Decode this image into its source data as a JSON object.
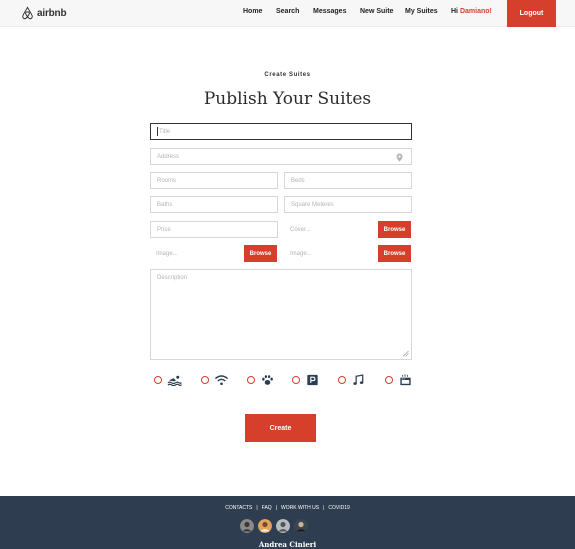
{
  "header": {
    "brand": "airbnb",
    "nav": [
      "Home",
      "Search",
      "Messages",
      "New Suite",
      "My Suites"
    ],
    "greeting": "Hi",
    "username": "Damiano!",
    "logout": "Logout"
  },
  "main": {
    "kicker": "Create Suites",
    "title": "Publish Your Suites"
  },
  "form": {
    "title_placeholder": "Title",
    "address_placeholder": "Address",
    "rooms_placeholder": "Rooms",
    "beds_placeholder": "Beds",
    "baths_placeholder": "Baths",
    "sqm_placeholder": "Square Meteres",
    "price_placeholder": "Price",
    "cover_placeholder": "Cover...",
    "image_placeholder": "Image...",
    "image2_placeholder": "Image...",
    "browse_label": "Browse",
    "description_placeholder": "Description",
    "amenities": [
      "pool-icon",
      "wifi-icon",
      "pets-icon",
      "parking-icon",
      "music-icon",
      "kitchen-icon"
    ],
    "create_label": "Create"
  },
  "footer": {
    "links": [
      "CONTACTS",
      "FAQ",
      "WORK WITH US",
      "COVID19"
    ],
    "separator": "|",
    "author": "Andrea Cinieri"
  },
  "colors": {
    "accent": "#d63f2c",
    "footer_bg": "#2e3e50"
  }
}
